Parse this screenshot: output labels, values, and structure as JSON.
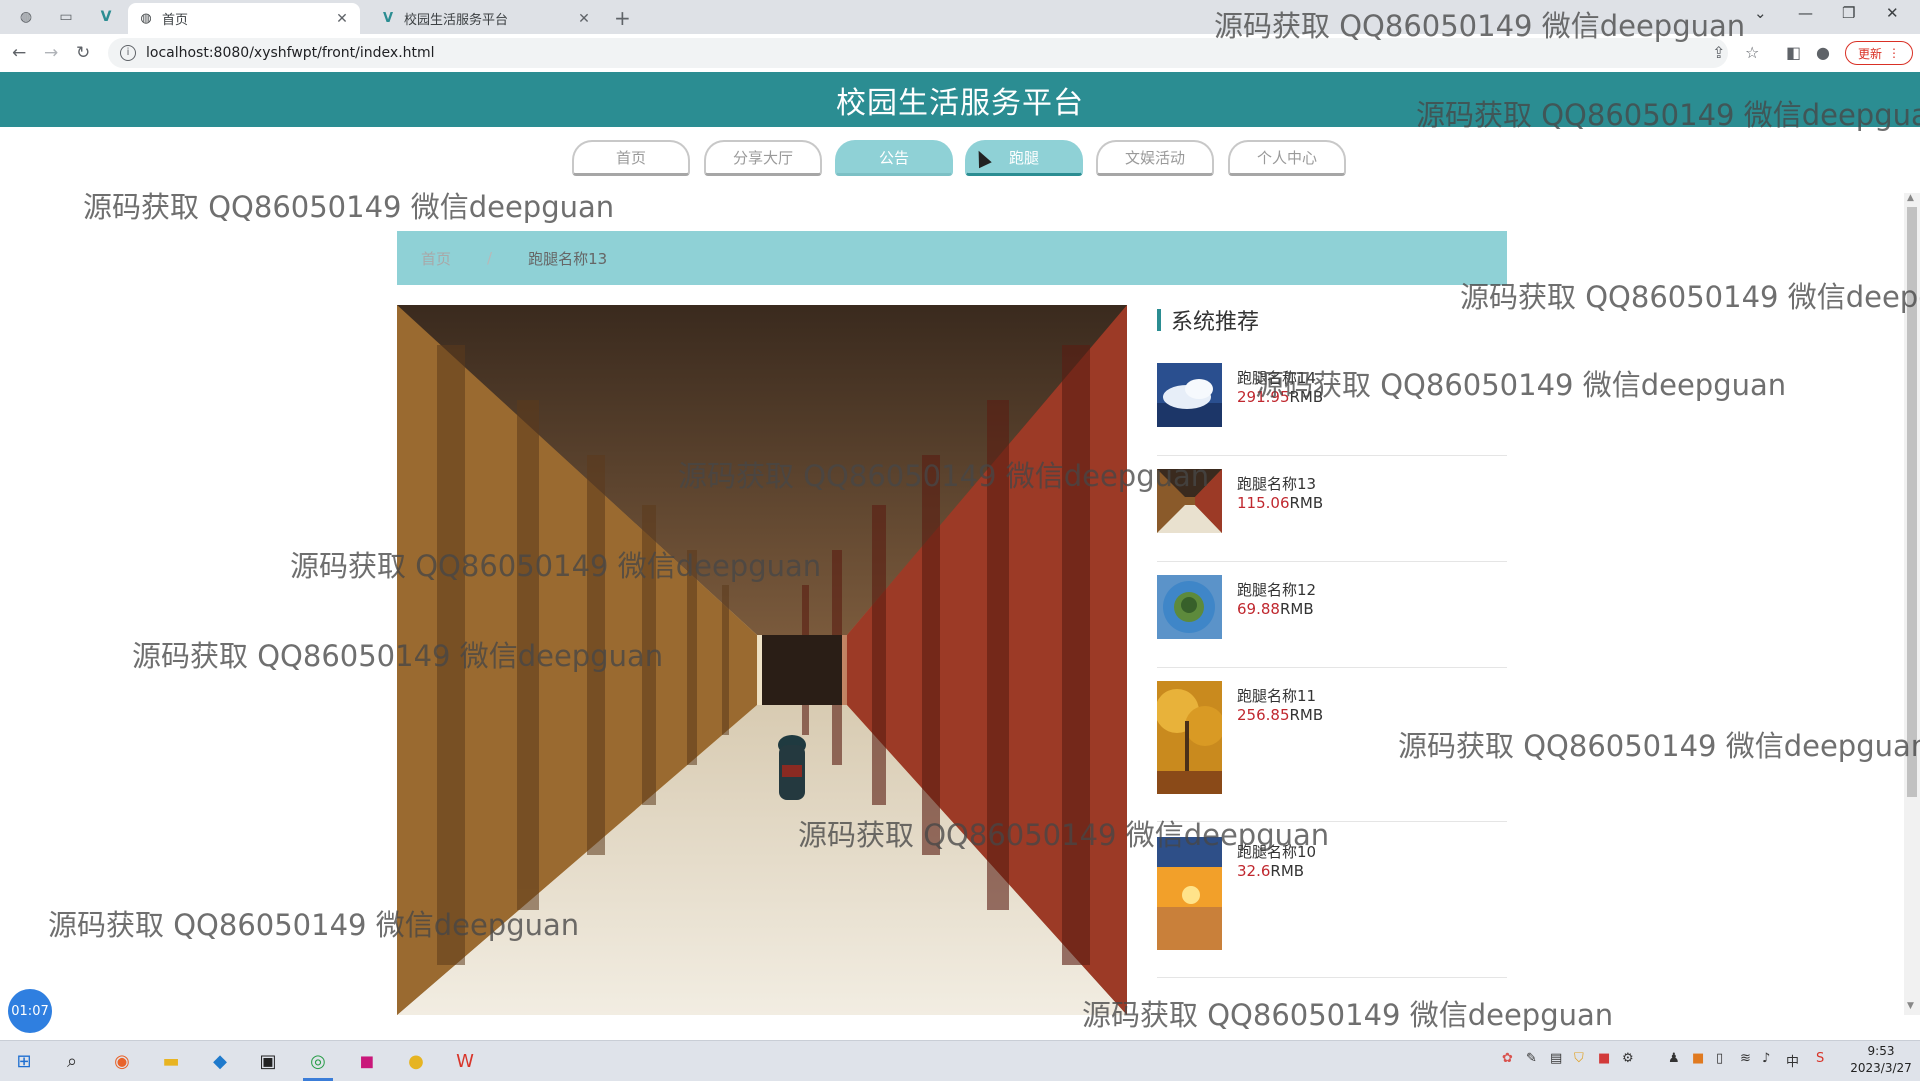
{
  "browser": {
    "tabs": [
      {
        "title": "首页",
        "active": true
      },
      {
        "title": "校园生活服务平台",
        "active": false
      }
    ],
    "url": "localhost:8080/xyshfwpt/front/index.html",
    "update_label": "更新"
  },
  "header": {
    "title": "校园生活服务平台"
  },
  "nav": {
    "items": [
      "首页",
      "分享大厅",
      "公告",
      "跑腿",
      "文娱活动",
      "个人中心"
    ],
    "active": "公告",
    "hover": "跑腿"
  },
  "breadcrumb": {
    "home": "首页",
    "separator": "/",
    "current": "跑腿名称13"
  },
  "sidebar": {
    "title": "系统推荐",
    "currency": "RMB",
    "items": [
      {
        "name": "跑腿名称14",
        "price": "291.95"
      },
      {
        "name": "跑腿名称13",
        "price": "115.06"
      },
      {
        "name": "跑腿名称12",
        "price": "69.88"
      },
      {
        "name": "跑腿名称11",
        "price": "256.85"
      },
      {
        "name": "跑腿名称10",
        "price": "32.6"
      }
    ]
  },
  "watermark": "源码获取 QQ86050149 微信deepguan",
  "timer": "01:07",
  "taskbar": {
    "time": "9:53",
    "date": "2023/3/27",
    "ime": "中"
  },
  "colors": {
    "header": "#2b8d92",
    "accent": "#8fd1d6",
    "price": "#c0282f"
  }
}
